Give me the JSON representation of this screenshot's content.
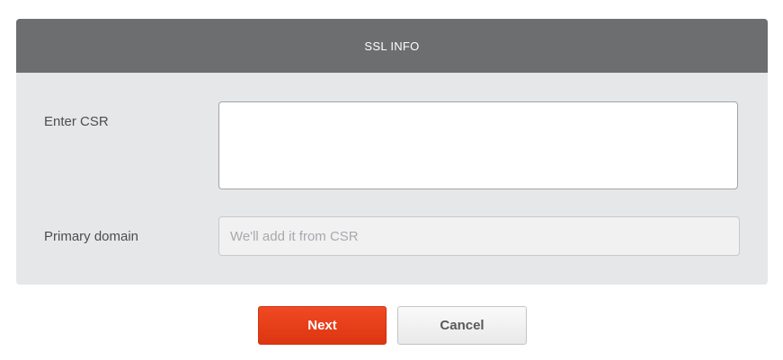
{
  "panel": {
    "title": "SSL INFO"
  },
  "form": {
    "csr_label": "Enter CSR",
    "csr_value": "",
    "domain_label": "Primary domain",
    "domain_value": "",
    "domain_placeholder": "We'll add it from CSR"
  },
  "actions": {
    "next_label": "Next",
    "cancel_label": "Cancel"
  },
  "colors": {
    "header_bg": "#6d6e70",
    "panel_bg": "#e6e7e8",
    "accent": "#e8401a"
  }
}
